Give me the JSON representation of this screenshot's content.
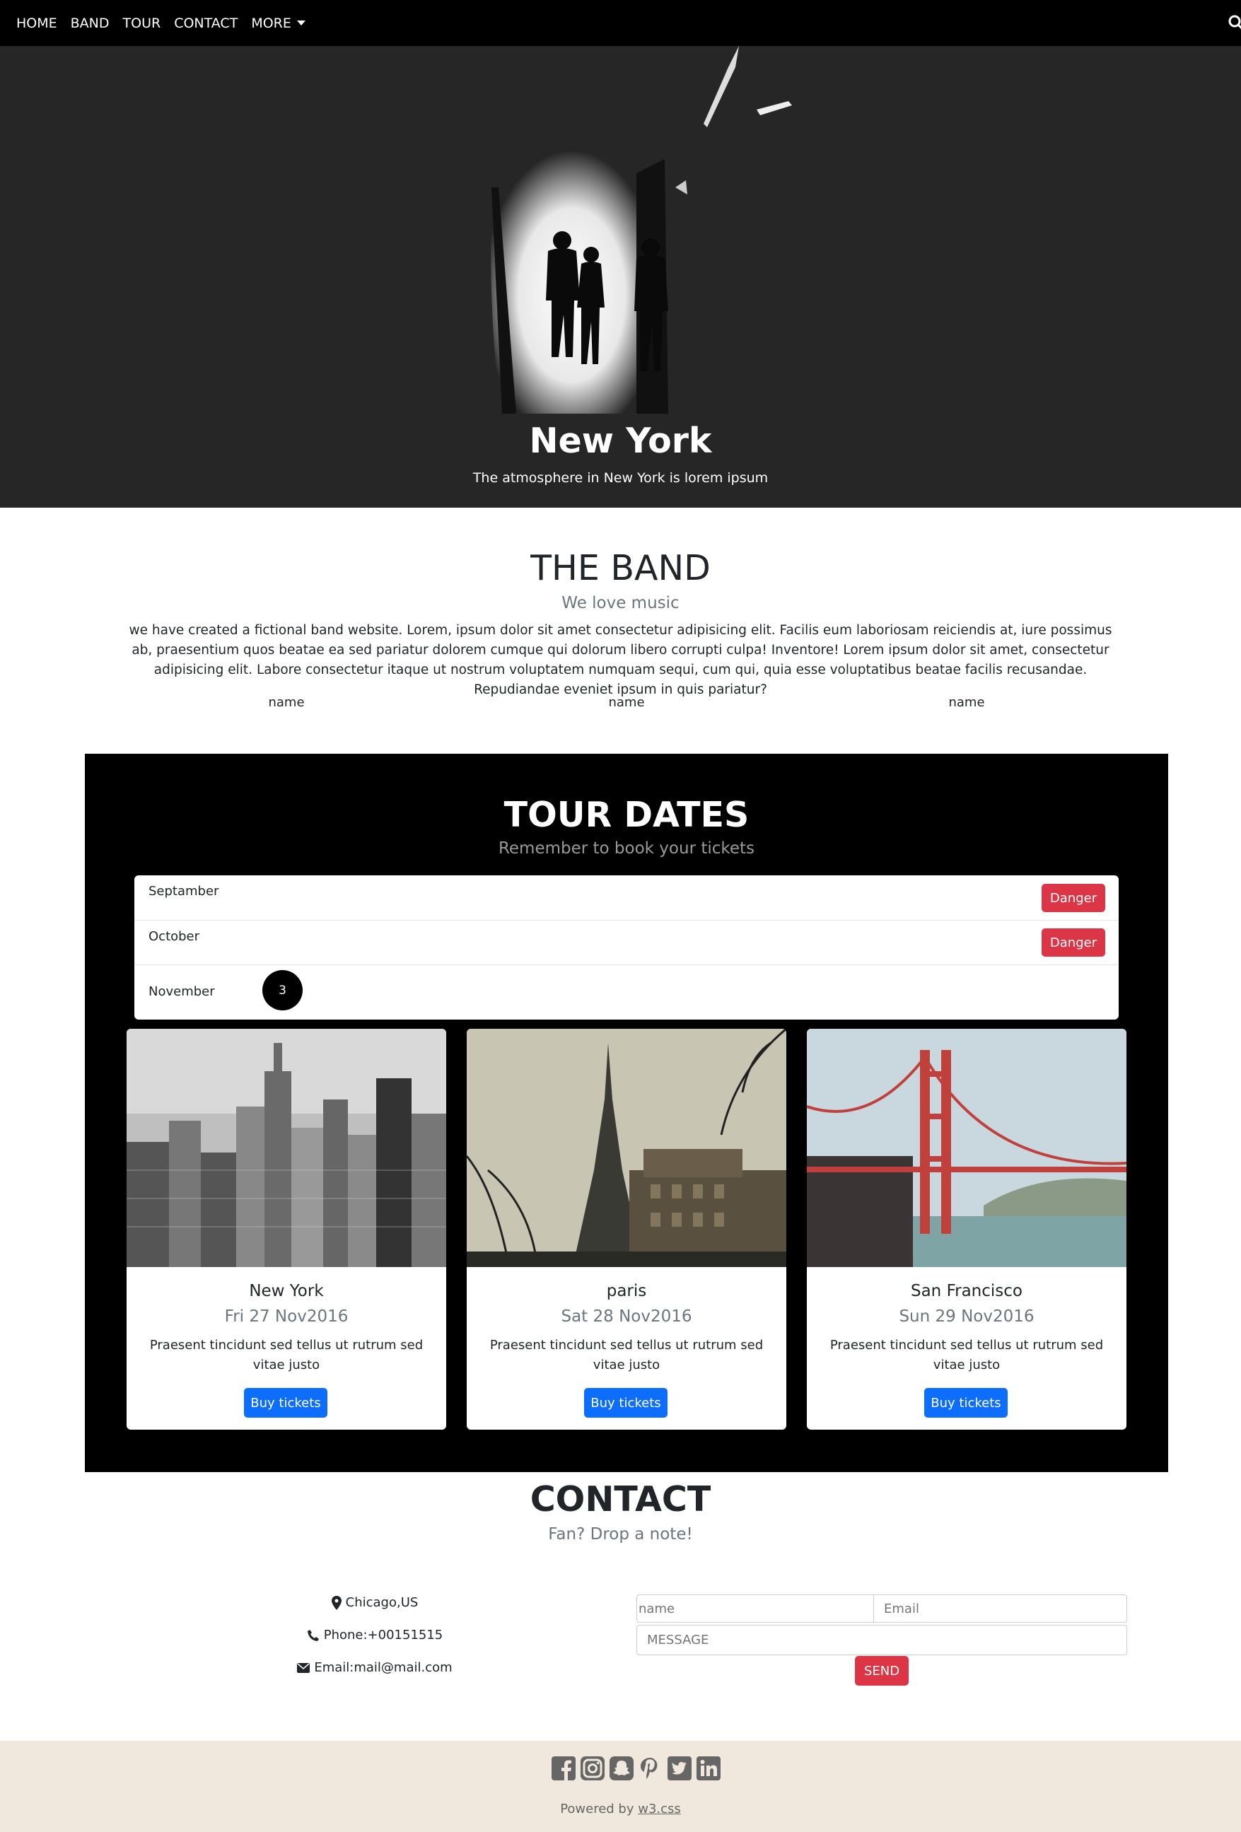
{
  "nav": {
    "items": [
      "HOME",
      "BAND",
      "TOUR",
      "CONTACT"
    ],
    "more_label": "MORE"
  },
  "hero": {
    "title": "New York",
    "subtitle": "The atmosphere in New York is lorem ipsum"
  },
  "band": {
    "title": "THE BAND",
    "subtitle": "We love music",
    "text": "we have created a fictional band website. Lorem, ipsum dolor sit amet consectetur adipisicing elit. Facilis eum laboriosam reiciendis at, iure possimus ab, praesentium quos beatae ea sed pariatur dolorem cumque qui dolorum libero corrupti culpa! Inventore! Lorem ipsum dolor sit amet, consectetur adipisicing elit. Labore consectetur itaque ut nostrum voluptatem numquam sequi, cum qui, quia esse voluptatibus beatae facilis recusandae. Repudiandae eveniet ipsum in quis pariatur?",
    "members": [
      "name",
      "name",
      "name"
    ]
  },
  "tour": {
    "title": "TOUR DATES",
    "subtitle": "Remember to book your tickets",
    "months": [
      {
        "label": "Septamber",
        "button": "Danger"
      },
      {
        "label": "October",
        "button": "Danger"
      },
      {
        "label": "November",
        "badge": "3"
      }
    ],
    "cards": [
      {
        "city": "New York",
        "date": "Fri 27 Nov2016",
        "text": "Praesent tincidunt sed tellus ut rutrum sed vitae justo",
        "button": "Buy tickets"
      },
      {
        "city": "paris",
        "date": "Sat 28 Nov2016",
        "text": "Praesent tincidunt sed tellus ut rutrum sed vitae justo",
        "button": "Buy tickets"
      },
      {
        "city": "San Francisco",
        "date": "Sun 29 Nov2016",
        "text": "Praesent tincidunt sed tellus ut rutrum sed vitae justo",
        "button": "Buy tickets"
      }
    ]
  },
  "contact": {
    "title": "CONTACT",
    "subtitle": "Fan? Drop a note!",
    "location": "Chicago,US",
    "phone": "Phone:+00151515",
    "email": "Email:mail@mail.com",
    "form": {
      "name_placeholder": "name",
      "email_placeholder": "Email",
      "message_placeholder": "MESSAGE",
      "send_label": "SEND"
    }
  },
  "footer": {
    "social_icons": [
      "facebook-icon",
      "instagram-icon",
      "snapchat-icon",
      "pinterest-icon",
      "twitter-icon",
      "linkedin-icon"
    ],
    "powered_prefix": "Powered by",
    "powered_link": "w3.css"
  },
  "colors": {
    "nav_bg": "#000000",
    "hero_bg": "#262626",
    "danger": "#dc3545",
    "primary": "#0d6efd",
    "footer_bg": "#f0e8dc"
  }
}
